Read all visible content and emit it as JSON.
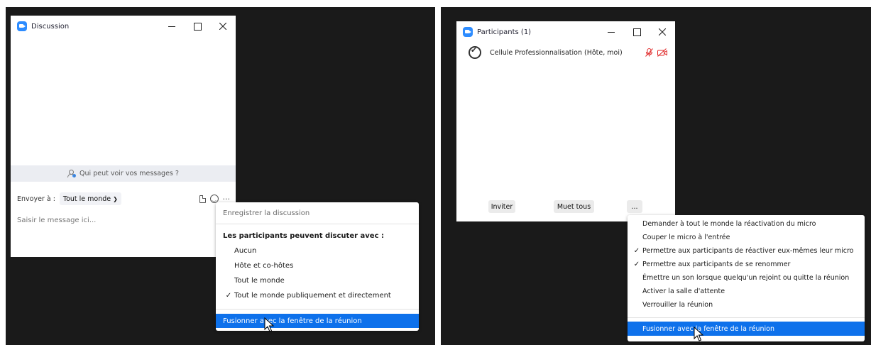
{
  "chat_window": {
    "title": "Discussion",
    "privacy_text": "Qui peut voir vos messages ?",
    "send_label": "Envoyer à :",
    "recipient": "Tout le monde",
    "more_label": "···",
    "message_placeholder": "Saisir le message ici..."
  },
  "chat_menu": {
    "save_chat": "Enregistrer la discussion",
    "section_title": "Les participants peuvent discuter avec :",
    "options": [
      {
        "label": "Aucun",
        "checked": false
      },
      {
        "label": "Hôte et co-hôtes",
        "checked": false
      },
      {
        "label": "Tout le monde",
        "checked": false
      },
      {
        "label": "Tout le monde publiquement et directement",
        "checked": true
      }
    ],
    "merge": "Fusionner avec la fenêtre de la réunion"
  },
  "participants_window": {
    "title": "Participants (1)",
    "participant_name": "Cellule Professionnalisation (Hôte, moi)",
    "invite": "Inviter",
    "mute_all": "Muet tous",
    "more": "..."
  },
  "participants_menu": {
    "items": [
      {
        "label": "Demander à tout le monde la réactivation du micro",
        "checked": false
      },
      {
        "label": "Couper le micro à l'entrée",
        "checked": false
      },
      {
        "label": "Permettre aux participants de réactiver eux-mêmes leur micro",
        "checked": true
      },
      {
        "label": "Permettre aux participants de se renommer",
        "checked": true
      },
      {
        "label": "Émettre un son lorsque quelqu'un rejoint ou quitte la réunion",
        "checked": false
      },
      {
        "label": "Activer la salle d'attente",
        "checked": false
      },
      {
        "label": "Verrouiller la réunion",
        "checked": false
      }
    ],
    "merge": "Fusionner avec la fenêtre de la réunion"
  },
  "colors": {
    "accent": "#0e71eb",
    "brand": "#2d8cff",
    "background": "#1a1a1a",
    "muted_red": "#e02828"
  },
  "check_mark": "✓",
  "window_controls": {
    "minimize": "minimize-icon",
    "maximize": "maximize-icon",
    "close": "close-icon"
  }
}
